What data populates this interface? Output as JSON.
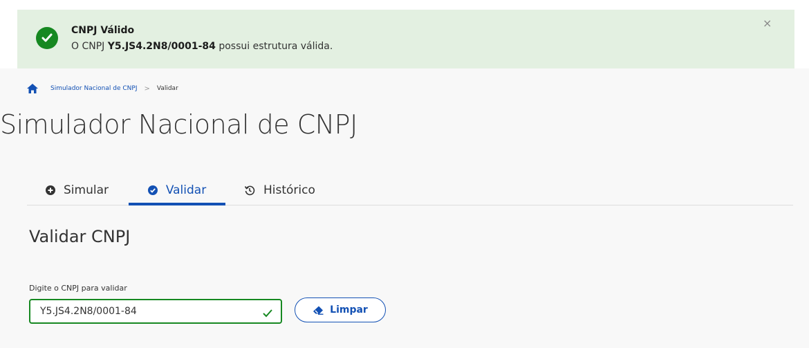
{
  "alert": {
    "title": "CNPJ Válido",
    "message_prefix": "O CNPJ ",
    "message_cnpj": "Y5.JS4.2N8/0001-84",
    "message_suffix": " possui estrutura válida.",
    "close": "×",
    "status_icon": "check-circle-icon",
    "color": "#168821"
  },
  "breadcrumb": {
    "home_icon": "home-icon",
    "link": "Simulador Nacional de CNPJ",
    "separator": ">",
    "current": "Validar"
  },
  "page": {
    "title": "Simulador Nacional de CNPJ"
  },
  "tabs": [
    {
      "label": "Simular",
      "icon": "plus-circle-icon",
      "active": false
    },
    {
      "label": "Validar",
      "icon": "check-circle-icon",
      "active": true
    },
    {
      "label": "Histórico",
      "icon": "history-icon",
      "active": false
    }
  ],
  "form": {
    "section_title": "Validar CNPJ",
    "label": "Digite o CNPJ para validar",
    "value": "Y5.JS4.2N8/0001-84",
    "clear_button": "Limpar"
  },
  "colors": {
    "primary": "#1351b4",
    "success": "#168821",
    "alert_bg": "#e3f0e1"
  }
}
